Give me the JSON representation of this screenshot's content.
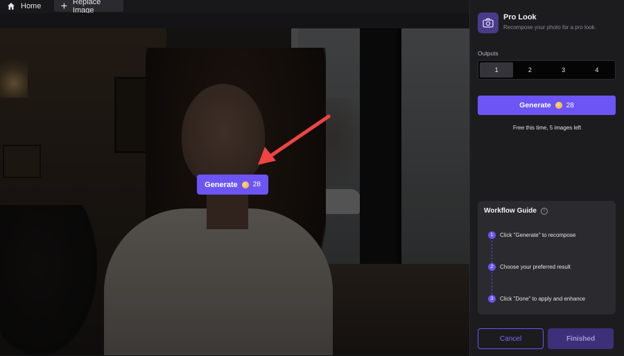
{
  "topbar": {
    "home_label": "Home",
    "replace_label": "Replace Image",
    "home_icon": "home-icon",
    "add_icon": "plus-icon"
  },
  "canvas": {
    "overlay_generate": {
      "label": "Generate",
      "cost": "28"
    }
  },
  "panel": {
    "tool_icon": "camera-icon",
    "title": "Pro Look",
    "subtitle": "Recompose your photo for a pro look.",
    "outputs_label": "Outputs",
    "outputs_options": [
      "1",
      "2",
      "3",
      "4"
    ],
    "outputs_selected": "1",
    "generate": {
      "label": "Generate",
      "cost": "28"
    },
    "free_note": "Free this time, 5 images left",
    "workflow": {
      "title": "Workflow Guide",
      "steps": [
        {
          "num": "1",
          "text": "Click \"Generate\" to recompose"
        },
        {
          "num": "2",
          "text": "Choose your preferred result"
        },
        {
          "num": "3",
          "text": "Click \"Done\" to apply and enhance"
        }
      ]
    },
    "cancel_label": "Cancel",
    "finished_label": "Finished"
  },
  "colors": {
    "accent": "#6c55f4",
    "panel_bg": "#1c1c1f",
    "arrow": "#ef4444"
  }
}
